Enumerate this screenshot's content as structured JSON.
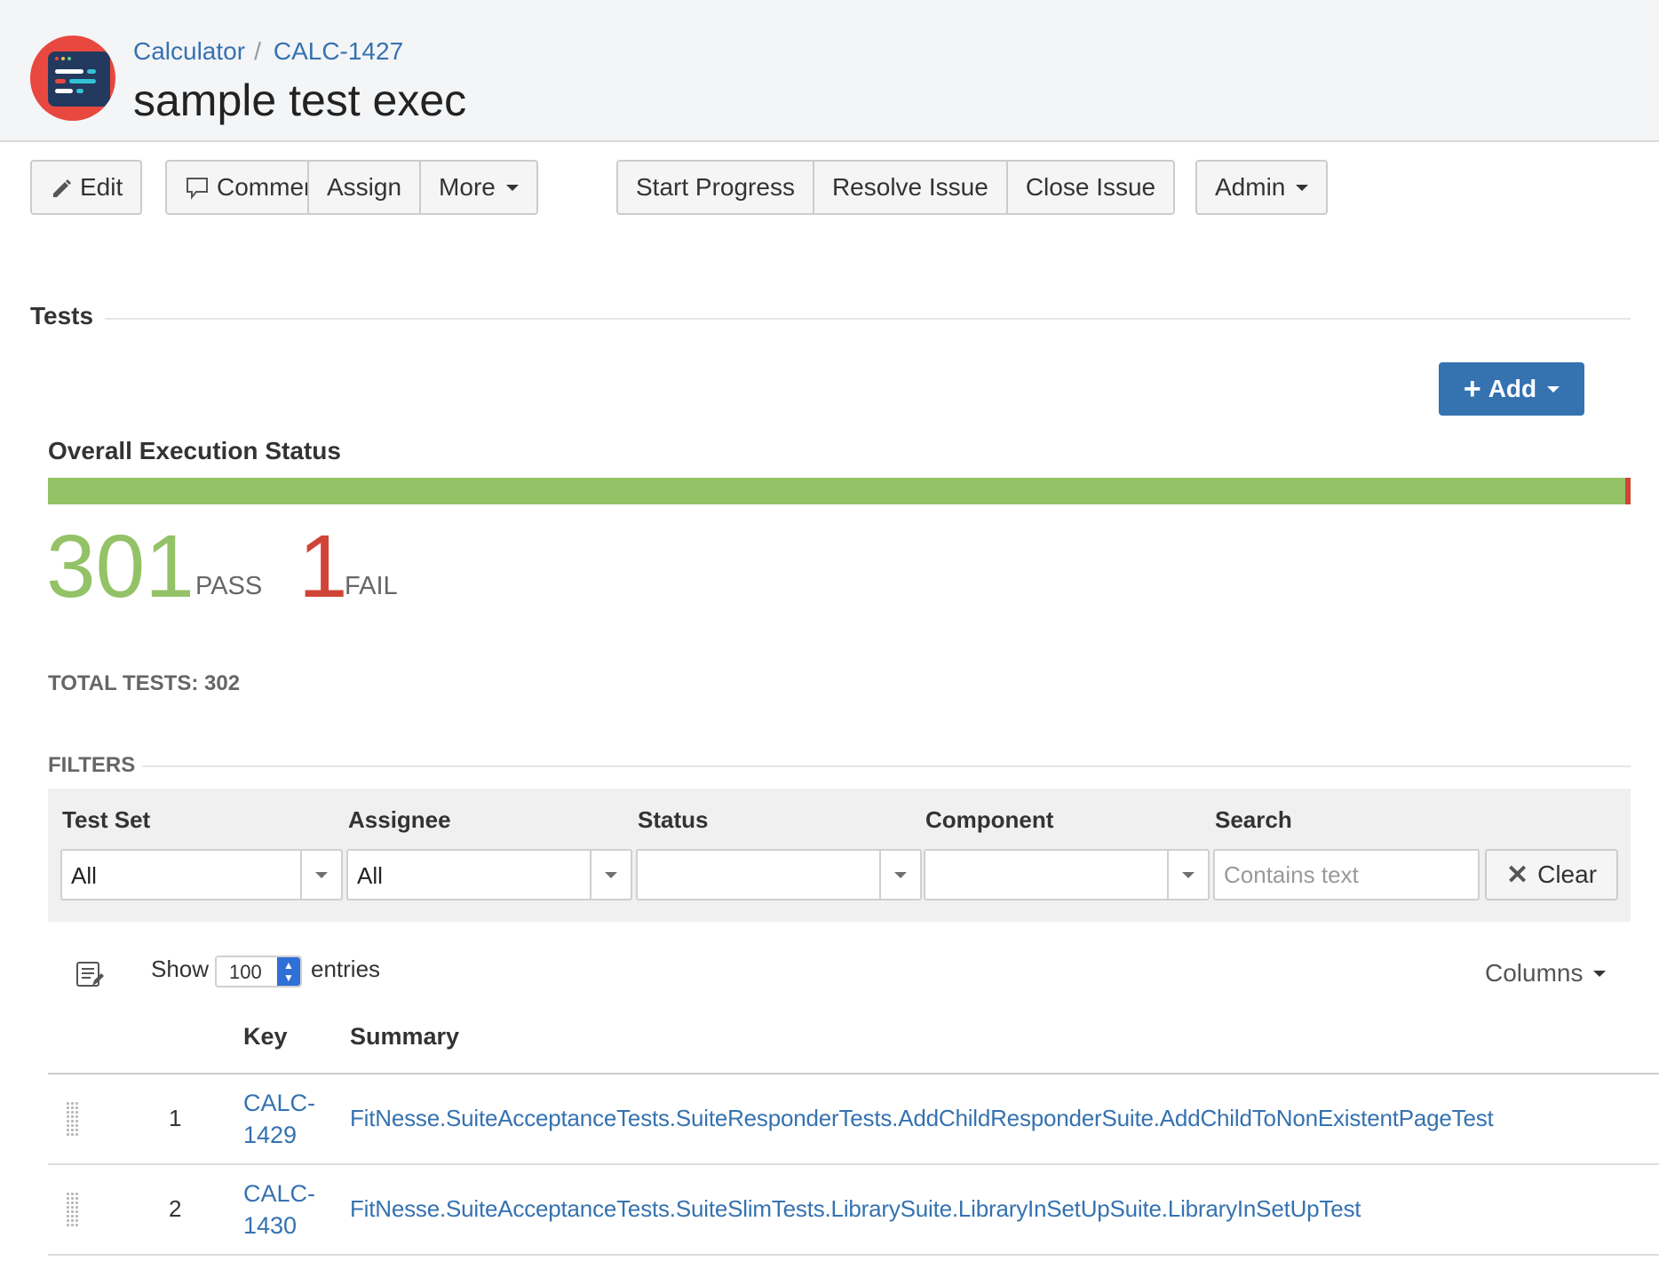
{
  "header": {
    "breadcrumb": [
      "Calculator",
      "CALC-1427"
    ],
    "breadcrumb_sep": "/",
    "title": "sample test exec",
    "logo_icon": "test-execution-icon"
  },
  "toolbar": {
    "edit": "Edit",
    "comment": "Comment",
    "assign": "Assign",
    "more": "More",
    "start_progress": "Start Progress",
    "resolve_issue": "Resolve Issue",
    "close_issue": "Close Issue",
    "admin": "Admin"
  },
  "tests_section": {
    "title": "Tests",
    "add_button": "Add",
    "overall_title": "Overall Execution Status",
    "pass_count": "301",
    "pass_label": "PASS",
    "fail_count": "1",
    "fail_label": "FAIL",
    "pass_fraction": 0.9967,
    "fail_fraction": 0.0033,
    "total": "TOTAL TESTS: 302",
    "colors": {
      "pass": "#94c267",
      "fail": "#d04437",
      "link": "#3572b0",
      "primary": "#3572b0"
    }
  },
  "filters": {
    "label": "FILTERS",
    "test_set_label": "Test Set",
    "test_set_value": "All",
    "assignee_label": "Assignee",
    "assignee_value": "All",
    "status_label": "Status",
    "status_value": "",
    "component_label": "Component",
    "component_value": "",
    "search_label": "Search",
    "search_placeholder": "Contains text",
    "clear_button": "Clear"
  },
  "table": {
    "show_label": "Show",
    "page_length": "100",
    "entries_label": "entries",
    "columns_button": "Columns",
    "headers": {
      "key": "Key",
      "summary": "Summary"
    },
    "rows": [
      {
        "num": "1",
        "key": "CALC-1429",
        "summary": "FitNesse.SuiteAcceptanceTests.SuiteResponderTests.AddChildResponderSuite.AddChildToNonExistentPageTest"
      },
      {
        "num": "2",
        "key": "CALC-1430",
        "summary": "FitNesse.SuiteAcceptanceTests.SuiteSlimTests.LibrarySuite.LibraryInSetUpSuite.LibraryInSetUpTest"
      }
    ]
  }
}
